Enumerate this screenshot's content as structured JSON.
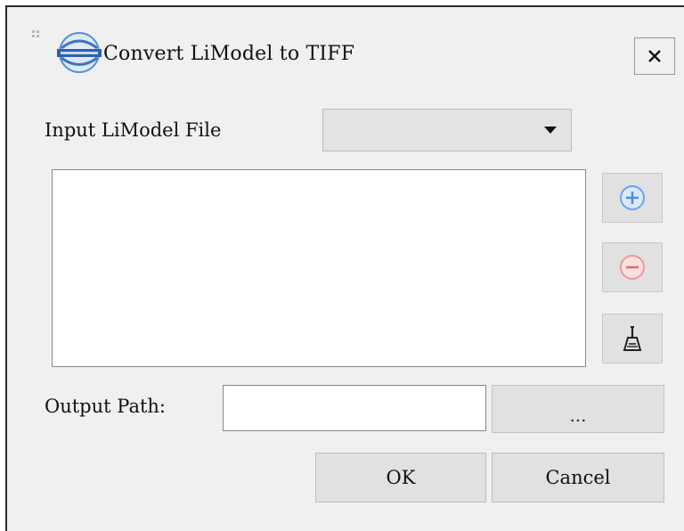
{
  "window": {
    "title": "Convert LiModel to TIFF",
    "close_glyph": "✕"
  },
  "input": {
    "label": "Input LiModel File",
    "selected_value": ""
  },
  "file_list": {
    "items": []
  },
  "side_buttons": {
    "add_icon": "plus-circle-icon",
    "remove_icon": "minus-circle-icon",
    "clear_icon": "broom-icon",
    "add_color": "#4a90e2",
    "remove_color": "#e06c6c"
  },
  "output": {
    "label": "Output Path:",
    "value": "",
    "browse_label": "..."
  },
  "actions": {
    "ok_label": "OK",
    "cancel_label": "Cancel"
  }
}
